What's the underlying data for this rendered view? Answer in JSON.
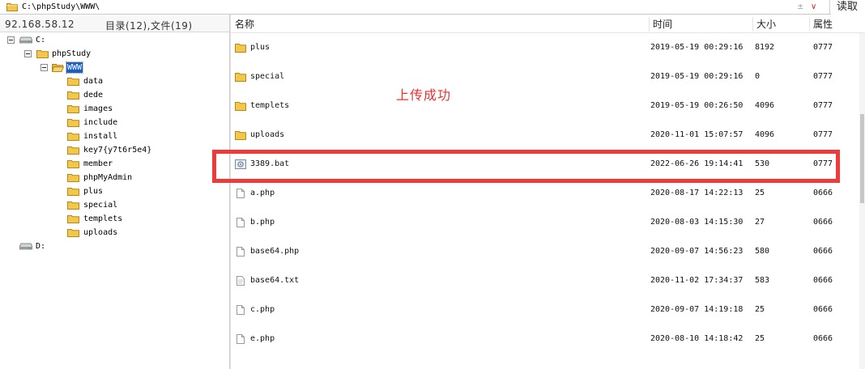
{
  "path_bar": {
    "value": "C:\\phpStudy\\WWW\\",
    "arrows": "± ",
    "read_label": "读取"
  },
  "info": {
    "ip": "92.168.58.12",
    "counts": "目录(12),文件(19)"
  },
  "tree": {
    "drive_c": "C:",
    "phpstudy": "phpStudy",
    "www": "WWW",
    "children": [
      "data",
      "dede",
      "images",
      "include",
      "install",
      "key7{y7t6r5e4}",
      "member",
      "phpMyAdmin",
      "plus",
      "special",
      "templets",
      "uploads"
    ],
    "drive_d": "D:"
  },
  "columns": {
    "name": "名称",
    "time": "时间",
    "size": "大小",
    "attr": "属性"
  },
  "files": [
    {
      "icon": "folder-icon",
      "name": "plus",
      "time": "2019-05-19 00:29:16",
      "size": "8192",
      "attr": "0777"
    },
    {
      "icon": "folder-icon",
      "name": "special",
      "time": "2019-05-19 00:29:16",
      "size": "0",
      "attr": "0777"
    },
    {
      "icon": "folder-icon",
      "name": "templets",
      "time": "2019-05-19 00:26:50",
      "size": "4096",
      "attr": "0777"
    },
    {
      "icon": "folder-icon",
      "name": "uploads",
      "time": "2020-11-01 15:07:57",
      "size": "4096",
      "attr": "0777"
    },
    {
      "icon": "batch-file-icon",
      "name": "3389.bat",
      "time": "2022-06-26 19:14:41",
      "size": "530",
      "attr": "0777"
    },
    {
      "icon": "file-icon",
      "name": "a.php",
      "time": "2020-08-17 14:22:13",
      "size": "25",
      "attr": "0666"
    },
    {
      "icon": "file-icon",
      "name": "b.php",
      "time": "2020-08-03 14:15:30",
      "size": "27",
      "attr": "0666"
    },
    {
      "icon": "file-icon",
      "name": "base64.php",
      "time": "2020-09-07 14:56:23",
      "size": "580",
      "attr": "0666"
    },
    {
      "icon": "text-file-icon",
      "name": "base64.txt",
      "time": "2020-11-02 17:34:37",
      "size": "583",
      "attr": "0666"
    },
    {
      "icon": "file-icon",
      "name": "c.php",
      "time": "2020-09-07 14:19:18",
      "size": "25",
      "attr": "0666"
    },
    {
      "icon": "file-icon",
      "name": "e.php",
      "time": "2020-08-10 14:18:42",
      "size": "25",
      "attr": "0666"
    }
  ],
  "annotation": {
    "text": "上传成功",
    "color": "#ee3030"
  },
  "colors": {
    "selection": "#1a5fc4",
    "folder": "#f2c84b",
    "highlight": "#ee3a3a"
  }
}
